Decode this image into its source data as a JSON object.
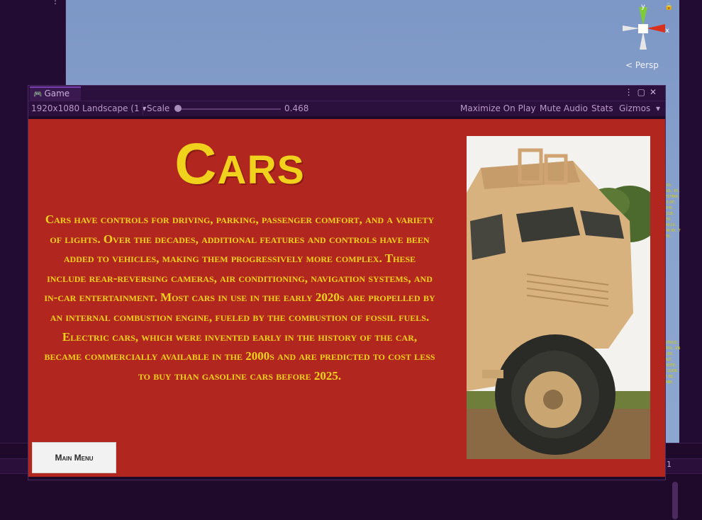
{
  "editor": {
    "scene_label": "Persp",
    "axis_x": "x",
    "axis_y": "y",
    "right_number": "1"
  },
  "game_window": {
    "tab_label": "Game",
    "toolbar": {
      "resolution": "1920x1080 Landscape (1",
      "scale_label": "Scale",
      "scale_value": "0.468",
      "maximize_on_play": "Maximize On Play",
      "mute_audio": "Mute Audio",
      "stats": "Stats",
      "gizmos": "Gizmos"
    }
  },
  "game_view": {
    "title": "Cars",
    "body": "Cars have controls for driving, parking, passenger comfort, and a variety of lights. Over the decades, additional features and controls have been added to vehicles, making them progressively more complex. These include rear-reversing cameras, air conditioning, navigation systems, and in-car entertainment. Most cars in use in the early 2020s are propelled by an internal combustion engine, fueled by the combustion of fossil fuels. Electric cars, which were invented early in the history of the car, became commercially available in the 2000s and are predicted to cost less to buy than gasoline cars before 2025.",
    "main_menu_button": "Main Menu",
    "image_subject": "armored-vehicle-photo"
  },
  "colors": {
    "game_background": "#b22620",
    "title_color": "#f0d21c",
    "editor_accent": "#7b3fb0"
  }
}
